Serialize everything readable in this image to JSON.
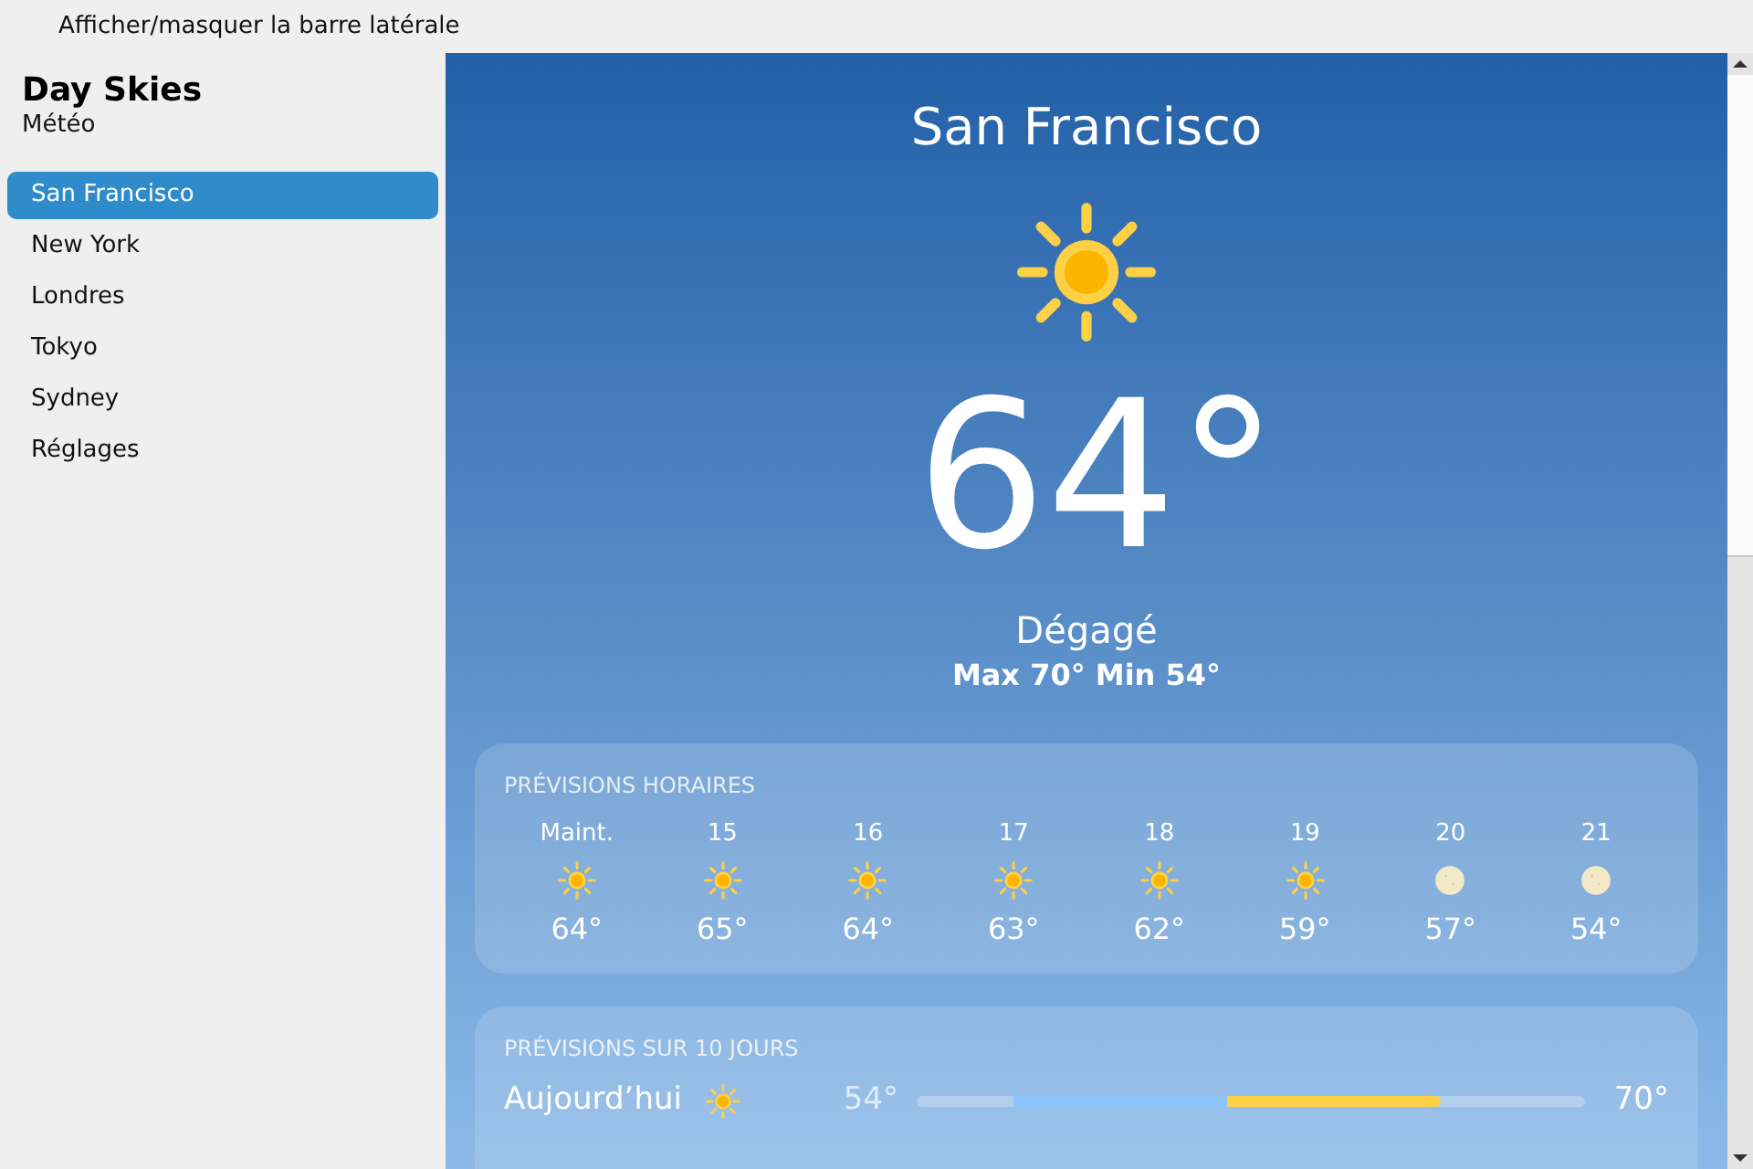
{
  "toolbar": {
    "toggle_label": "Afficher/masquer la barre latérale"
  },
  "sidebar": {
    "title": "Day Skies",
    "subtitle": "Météo",
    "items": [
      {
        "label": "San Francisco",
        "selected": true
      },
      {
        "label": "New York",
        "selected": false
      },
      {
        "label": "Londres",
        "selected": false
      },
      {
        "label": "Tokyo",
        "selected": false
      },
      {
        "label": "Sydney",
        "selected": false
      },
      {
        "label": "Réglages",
        "selected": false
      }
    ]
  },
  "current": {
    "city": "San Francisco",
    "kind": "sun",
    "temperature": "64°",
    "condition": "Dégagé",
    "high_low": "Max 70° Min 54°"
  },
  "hourly": {
    "title": "PRÉVISIONS HORAIRES",
    "hours": [
      {
        "time": "Maint.",
        "kind": "sun",
        "temp": "64°"
      },
      {
        "time": "15",
        "kind": "sun",
        "temp": "65°"
      },
      {
        "time": "16",
        "kind": "sun",
        "temp": "64°"
      },
      {
        "time": "17",
        "kind": "sun",
        "temp": "63°"
      },
      {
        "time": "18",
        "kind": "sun",
        "temp": "62°"
      },
      {
        "time": "19",
        "kind": "sun",
        "temp": "59°"
      },
      {
        "time": "20",
        "kind": "moon",
        "temp": "57°"
      },
      {
        "time": "21",
        "kind": "moon",
        "temp": "54°"
      }
    ]
  },
  "daily": {
    "title": "PRÉVISIONS SUR 10 JOURS",
    "days": [
      {
        "day": "Aujourd’hui",
        "kind": "sun",
        "low": "54°",
        "high": "70°"
      }
    ]
  }
}
